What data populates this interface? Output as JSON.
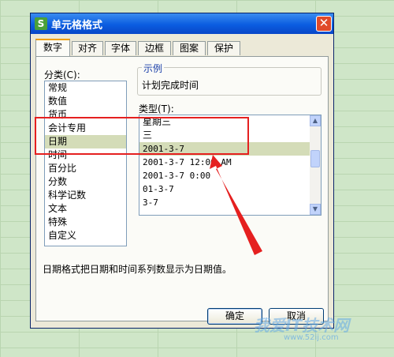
{
  "window": {
    "title": "单元格格式",
    "app_icon_text": "S",
    "close_glyph": "✕"
  },
  "tabs": [
    {
      "label": "数字",
      "active": true
    },
    {
      "label": "对齐"
    },
    {
      "label": "字体"
    },
    {
      "label": "边框"
    },
    {
      "label": "图案"
    },
    {
      "label": "保护"
    }
  ],
  "category": {
    "label": "分类(C):",
    "items": [
      "常规",
      "数值",
      "货币",
      "会计专用",
      "日期",
      "时间",
      "百分比",
      "分数",
      "科学记数",
      "文本",
      "特殊",
      "自定义"
    ],
    "selected": "日期"
  },
  "example": {
    "legend": "示例",
    "value": "计划完成时间"
  },
  "type": {
    "label": "类型(T):",
    "items": [
      "星期三",
      "三",
      "2001-3-7",
      "2001-3-7 12:00 AM",
      "2001-3-7 0:00",
      "01-3-7",
      "3-7"
    ],
    "selected": "2001-3-7"
  },
  "description": "日期格式把日期和时间系列数显示为日期值。",
  "buttons": {
    "ok": "确定",
    "cancel": "取消"
  },
  "watermark": {
    "text": "我爱IT技术网",
    "url": "www.52ij.com"
  },
  "colors": {
    "highlight_box": "#e52020",
    "selection": "#d4dcb8",
    "title_bar": "#0b5de0"
  }
}
